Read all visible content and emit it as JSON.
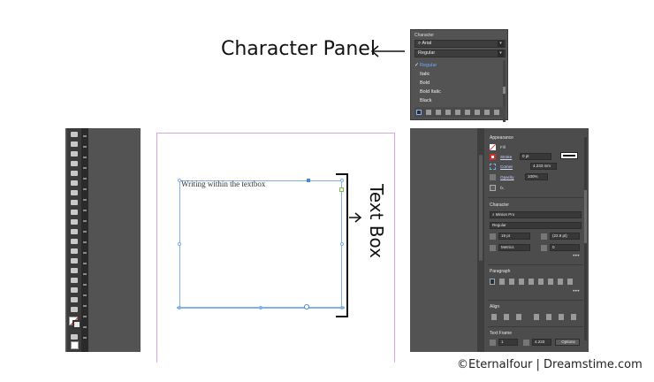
{
  "callouts": {
    "character_panel": "Character Panel",
    "text_box": "Text Box"
  },
  "character_dropdown": {
    "title": "Character",
    "font_family": "Arial",
    "font_style": "Regular",
    "style_options": [
      "Regular",
      "Italic",
      "Bold",
      "Bold Italic",
      "Black"
    ],
    "selected_option": "Regular"
  },
  "document": {
    "textbox_text": "Writing within the textbox"
  },
  "properties": {
    "appearance": {
      "header": "Appearance",
      "fill_label": "Fill",
      "stroke_label": "Stroke",
      "stroke_value": "0 pt",
      "corner_label": "Corner",
      "corner_value": "4.233 mm",
      "opacity_label": "Opacity",
      "opacity_value": "100%",
      "fx_label": "fx."
    },
    "character": {
      "header": "Character",
      "font_family": "Minion Pro",
      "font_style": "Regular",
      "font_size": "19 pt",
      "leading": "(22.8 pt)",
      "kerning": "Metrics",
      "tracking": "0"
    },
    "paragraph": {
      "header": "Paragraph"
    },
    "align": {
      "header": "Align"
    },
    "text_frame": {
      "header": "Text Frame",
      "columns": "1",
      "width": "4.233",
      "options_button": "Options"
    }
  },
  "credit": "©Eternalfour | Dreamstime.com",
  "colors": {
    "panel_bg": "#535353",
    "selection_blue": "#7fb2e5",
    "page_margin_magenta": "#d6a6e0",
    "selected_option_blue": "#6ea8ff"
  }
}
